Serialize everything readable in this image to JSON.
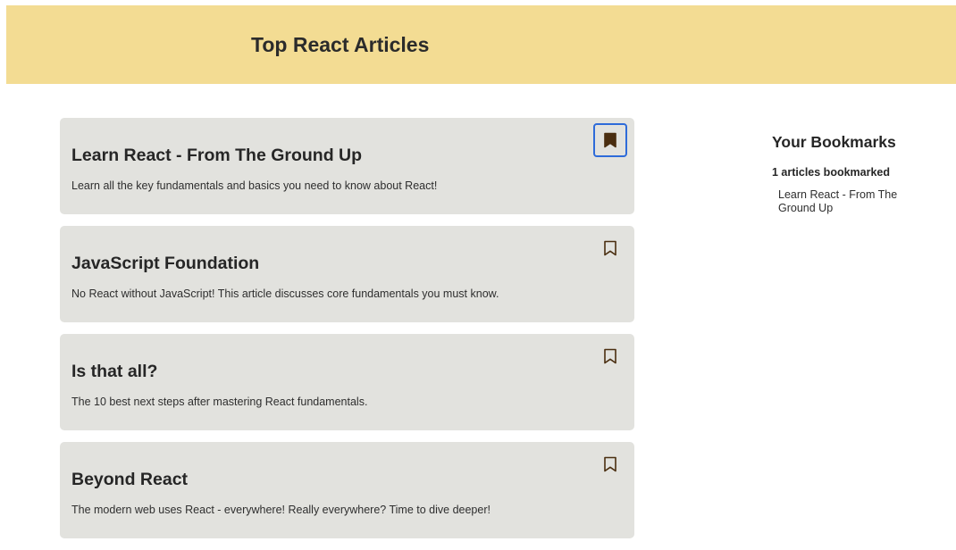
{
  "header": {
    "title": "Top React Articles"
  },
  "colors": {
    "header_bg": "#f3dc93",
    "card_bg": "#e2e2de",
    "bookmark_icon": "#4a2e10",
    "focus_outline": "#2e6bd9"
  },
  "articles": [
    {
      "title": "Learn React - From The Ground Up",
      "description": "Learn all the key fundamentals and basics you need to know about React!",
      "bookmarked": true,
      "icon": "bookmark-filled-icon"
    },
    {
      "title": "JavaScript Foundation",
      "description": "No React without JavaScript! This article discusses core fundamentals you must know.",
      "bookmarked": false,
      "icon": "bookmark-outline-icon"
    },
    {
      "title": "Is that all?",
      "description": "The 10 best next steps after mastering React fundamentals.",
      "bookmarked": false,
      "icon": "bookmark-outline-icon"
    },
    {
      "title": "Beyond React",
      "description": "The modern web uses React - everywhere! Really everywhere? Time to dive deeper!",
      "bookmarked": false,
      "icon": "bookmark-outline-icon"
    }
  ],
  "sidebar": {
    "title": "Your Bookmarks",
    "count_label": "1 articles bookmarked",
    "items": [
      "Learn React - From The Ground Up"
    ]
  }
}
